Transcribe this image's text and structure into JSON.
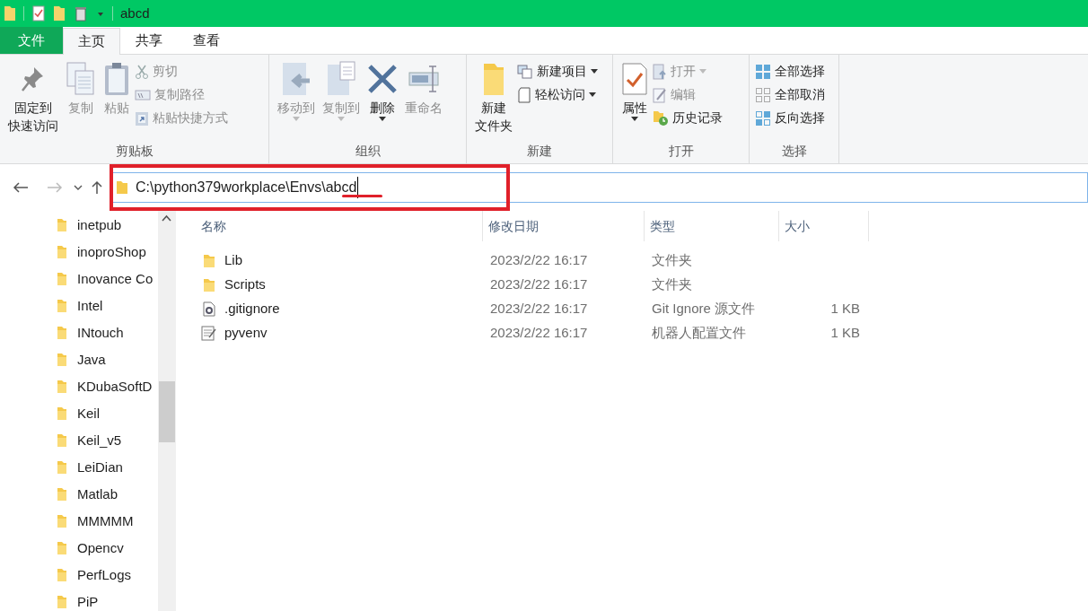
{
  "window": {
    "title": "abcd"
  },
  "ribbon_tabs": [
    {
      "label": "文件",
      "kind": "file",
      "selected": false
    },
    {
      "label": "主页",
      "kind": "tab",
      "selected": true
    },
    {
      "label": "共享",
      "kind": "tab",
      "selected": false
    },
    {
      "label": "查看",
      "kind": "tab",
      "selected": false
    }
  ],
  "ribbon_groups": [
    {
      "title": "剪贴板",
      "items": [
        {
          "lines": [
            "固定到",
            "快速访问"
          ],
          "kind": "large",
          "disabled": false,
          "dropdown": false
        },
        {
          "label": "复制",
          "kind": "large",
          "disabled": true,
          "dropdown": false
        },
        {
          "label": "粘贴",
          "kind": "large",
          "disabled": true,
          "dropdown": false
        },
        {
          "label": "剪切",
          "kind": "small",
          "disabled": true,
          "dropdown": false
        },
        {
          "label": "复制路径",
          "kind": "small",
          "disabled": true,
          "dropdown": false
        },
        {
          "label": "粘贴快捷方式",
          "kind": "small",
          "disabled": true,
          "dropdown": false
        }
      ]
    },
    {
      "title": "组织",
      "items": [
        {
          "label": "移动到",
          "kind": "large",
          "disabled": true,
          "dropdown": true
        },
        {
          "label": "复制到",
          "kind": "large",
          "disabled": true,
          "dropdown": true
        },
        {
          "label": "删除",
          "kind": "large",
          "disabled": false,
          "dropdown": true
        },
        {
          "label": "重命名",
          "kind": "large",
          "disabled": true,
          "dropdown": false
        }
      ]
    },
    {
      "title": "新建",
      "items": [
        {
          "lines": [
            "新建",
            "文件夹"
          ],
          "kind": "large",
          "disabled": false,
          "dropdown": false
        },
        {
          "label": "新建项目",
          "kind": "small",
          "disabled": false,
          "dropdown": true
        },
        {
          "label": "轻松访问",
          "kind": "small",
          "disabled": false,
          "dropdown": true
        }
      ]
    },
    {
      "title": "打开",
      "items": [
        {
          "label": "属性",
          "kind": "large",
          "disabled": false,
          "dropdown": true
        },
        {
          "label": "打开",
          "kind": "small",
          "disabled": true,
          "dropdown": true
        },
        {
          "label": "编辑",
          "kind": "small",
          "disabled": true,
          "dropdown": false
        },
        {
          "label": "历史记录",
          "kind": "small",
          "disabled": false,
          "dropdown": false
        }
      ]
    },
    {
      "title": "选择",
      "items": [
        {
          "label": "全部选择",
          "kind": "small",
          "disabled": false,
          "dropdown": false
        },
        {
          "label": "全部取消",
          "kind": "small",
          "disabled": false,
          "dropdown": false
        },
        {
          "label": "反向选择",
          "kind": "small",
          "disabled": false,
          "dropdown": false
        }
      ]
    }
  ],
  "address_bar": {
    "path": "C:\\python379workplace\\Envs\\abcd"
  },
  "navigation_pane": {
    "items": [
      {
        "label": "inetpub"
      },
      {
        "label": "inoproShop"
      },
      {
        "label": "Inovance Co"
      },
      {
        "label": "Intel"
      },
      {
        "label": "INtouch"
      },
      {
        "label": "Java"
      },
      {
        "label": "KDubaSoftD"
      },
      {
        "label": "Keil"
      },
      {
        "label": "Keil_v5"
      },
      {
        "label": "LeiDian"
      },
      {
        "label": "Matlab"
      },
      {
        "label": "MMMMM"
      },
      {
        "label": "Opencv"
      },
      {
        "label": "PerfLogs"
      },
      {
        "label": "PiP"
      }
    ]
  },
  "file_list": {
    "columns": [
      "名称",
      "修改日期",
      "类型",
      "大小"
    ],
    "rows": [
      {
        "kind": "folder",
        "name": "Lib",
        "date": "2023/2/22 16:17",
        "type": "文件夹"
      },
      {
        "kind": "folder",
        "name": "Scripts",
        "date": "2023/2/22 16:17",
        "type": "文件夹"
      },
      {
        "kind": "config",
        "name": ".gitignore",
        "date": "2023/2/22 16:17",
        "type": "Git Ignore 源文件",
        "size": "1 KB"
      },
      {
        "kind": "text",
        "name": "pyvenv",
        "date": "2023/2/22 16:17",
        "type": "机器人配置文件",
        "size": "1 KB"
      }
    ]
  }
}
